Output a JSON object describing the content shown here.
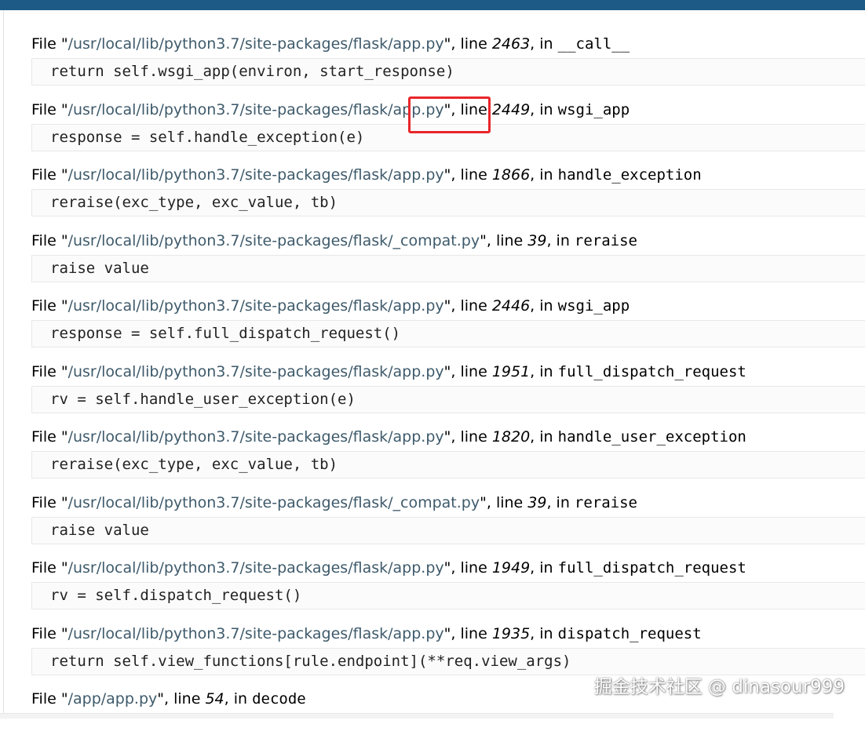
{
  "traceback": {
    "frames": [
      {
        "path": "/usr/local/lib/python3.7/site-packages/flask/app.py",
        "line": "2463",
        "func": "__call__",
        "code": "return self.wsgi_app(environ, start_response)"
      },
      {
        "path": "/usr/local/lib/python3.7/site-packages/flask/app.py",
        "line": "2449",
        "func": "wsgi_app",
        "code": "response = self.handle_exception(e)"
      },
      {
        "path": "/usr/local/lib/python3.7/site-packages/flask/app.py",
        "line": "1866",
        "func": "handle_exception",
        "code": "reraise(exc_type, exc_value, tb)"
      },
      {
        "path": "/usr/local/lib/python3.7/site-packages/flask/_compat.py",
        "line": "39",
        "func": "reraise",
        "code": "raise value"
      },
      {
        "path": "/usr/local/lib/python3.7/site-packages/flask/app.py",
        "line": "2446",
        "func": "wsgi_app",
        "code": "response = self.full_dispatch_request()"
      },
      {
        "path": "/usr/local/lib/python3.7/site-packages/flask/app.py",
        "line": "1951",
        "func": "full_dispatch_request",
        "code": "rv = self.handle_user_exception(e)"
      },
      {
        "path": "/usr/local/lib/python3.7/site-packages/flask/app.py",
        "line": "1820",
        "func": "handle_user_exception",
        "code": "reraise(exc_type, exc_value, tb)"
      },
      {
        "path": "/usr/local/lib/python3.7/site-packages/flask/_compat.py",
        "line": "39",
        "func": "reraise",
        "code": "raise value"
      },
      {
        "path": "/usr/local/lib/python3.7/site-packages/flask/app.py",
        "line": "1949",
        "func": "full_dispatch_request",
        "code": "rv = self.dispatch_request()"
      },
      {
        "path": "/usr/local/lib/python3.7/site-packages/flask/app.py",
        "line": "1935",
        "func": "dispatch_request",
        "code": "return self.view_functions[rule.endpoint](**req.view_args)"
      },
      {
        "path": "/app/app.py",
        "line": "54",
        "func": "decode",
        "code": ""
      }
    ],
    "labels": {
      "file": "File ",
      "line": ", line ",
      "in": ", in "
    }
  },
  "watermark": "掘金技术社区 @ dinasour999",
  "colors": {
    "topbar": "#1d5a86",
    "path": "#3e5a6b",
    "highlight": "#e8262b"
  }
}
